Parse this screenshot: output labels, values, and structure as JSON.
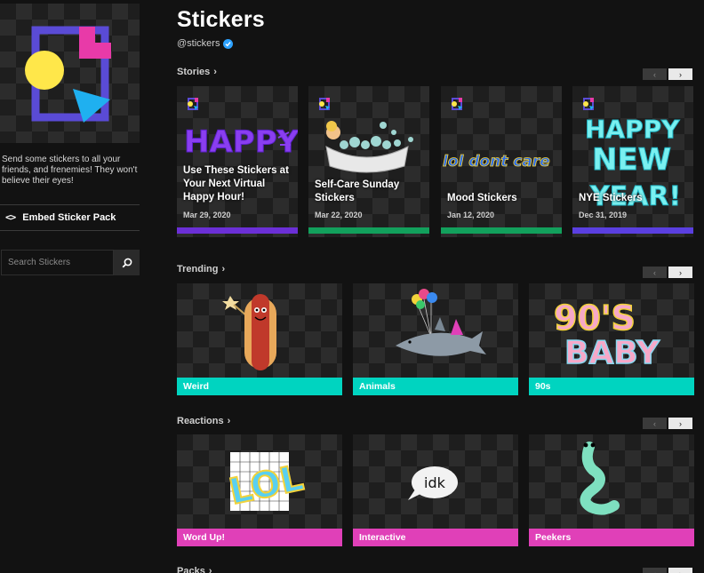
{
  "sidebar": {
    "description": "Send some stickers to all your friends, and frenemies! They won't believe their eyes!",
    "embed_icon": "<>",
    "embed_label": "Embed Sticker Pack",
    "search_placeholder": "Search Stickers"
  },
  "header": {
    "title": "Stickers",
    "handle": "@stickers"
  },
  "sections": {
    "stories": {
      "label": "Stories",
      "chevron": "›"
    },
    "trending": {
      "label": "Trending",
      "chevron": "›"
    },
    "reactions": {
      "label": "Reactions",
      "chevron": "›"
    },
    "packs": {
      "label": "Packs",
      "chevron": "›"
    }
  },
  "nav": {
    "prev": "‹",
    "next": "›"
  },
  "stories": [
    {
      "title": "Use These Stickers at Your Next Virtual Happy Hour!",
      "date": "Mar 29, 2020",
      "art_text": "HAPPY",
      "bar_color": "#6b2fd6"
    },
    {
      "title": "Self-Care Sunday Stickers",
      "date": "Mar 22, 2020",
      "bar_color": "#12a05c"
    },
    {
      "title": "Mood Stickers",
      "date": "Jan 12, 2020",
      "art_text": "lol dont care",
      "bar_color": "#12a05c"
    },
    {
      "title": "NYE Stickers",
      "date": "Dec 31, 2019",
      "art_text_1": "HAPPY",
      "art_text_2": "NEW",
      "art_text_3": "YEAR!",
      "bar_color": "#5a3fe0"
    }
  ],
  "trending": [
    {
      "label": "Weird",
      "color": "#00d4c0"
    },
    {
      "label": "Animals",
      "color": "#00d4c0"
    },
    {
      "label": "90s",
      "color": "#00d4c0",
      "art_text_1": "90'S",
      "art_text_2": "BABY"
    }
  ],
  "reactions": [
    {
      "label": "Word Up!",
      "color": "#e040b8",
      "art_text": "LOL"
    },
    {
      "label": "Interactive",
      "color": "#e040b8",
      "art_text": "idk"
    },
    {
      "label": "Peekers",
      "color": "#e040b8"
    }
  ],
  "colors": {
    "background": "#121212",
    "accent_teal": "#00d4c0",
    "accent_pink": "#e040b8",
    "verified_blue": "#2da2ff"
  }
}
